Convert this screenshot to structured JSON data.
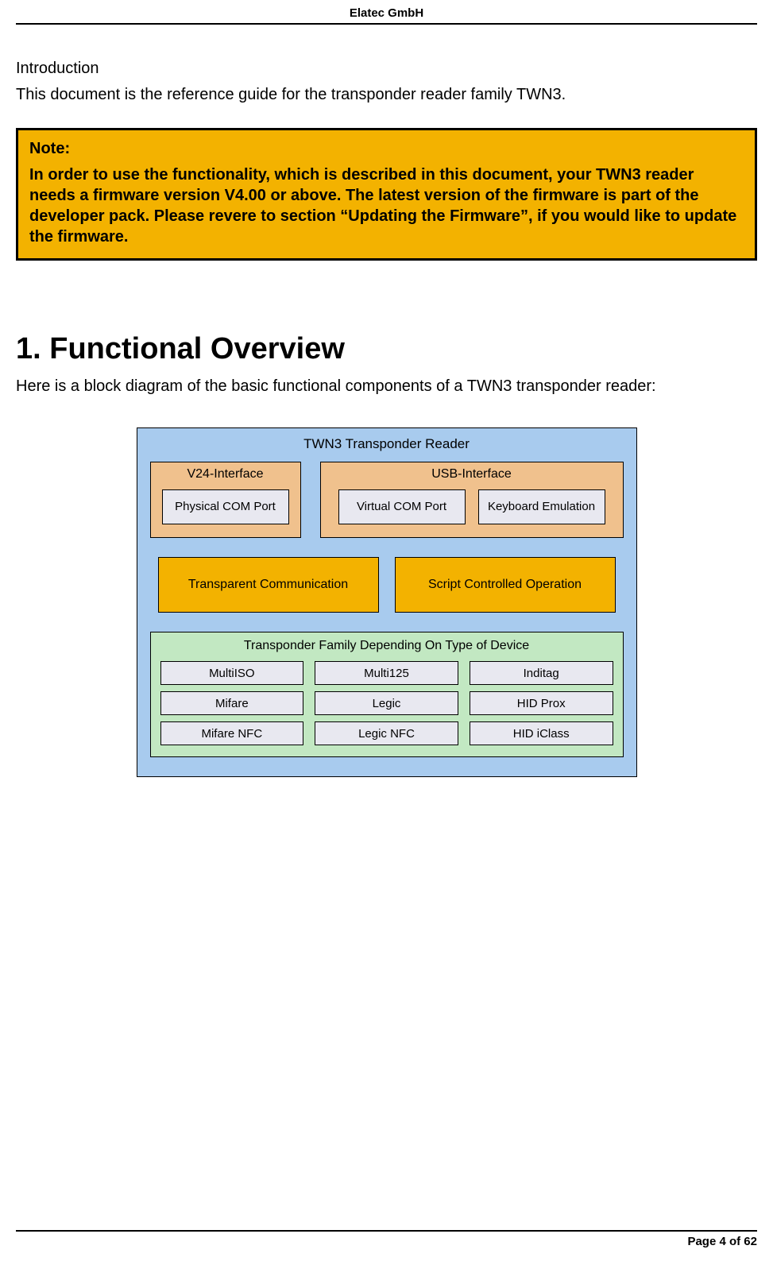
{
  "header": {
    "company": "Elatec GmbH"
  },
  "intro": {
    "label": "Introduction",
    "text": "This document is the reference guide for the transponder reader family TWN3."
  },
  "note": {
    "title": "Note:",
    "body": "In order to use the functionality, which is described in this document, your TWN3 reader needs a firmware version V4.00 or above. The latest version of the firmware is part of the developer pack. Please revere to section “Updating the Firmware”, if you would like to update the firmware."
  },
  "section": {
    "heading": "1. Functional Overview",
    "text": "Here is a block diagram of the basic functional components of a TWN3 transponder reader:"
  },
  "diagram": {
    "title": "TWN3 Transponder Reader",
    "v24": {
      "label": "V24-Interface",
      "port": "Physical COM Port"
    },
    "usb": {
      "label": "USB-Interface",
      "port1": "Virtual COM Port",
      "port2": "Keyboard Emulation"
    },
    "mode1": "Transparent Communication",
    "mode2": "Script Controlled Operation",
    "family": {
      "title": "Transponder Family Depending On Type of Device",
      "cells": [
        "MultiISO",
        "Multi125",
        "Inditag",
        "Mifare",
        "Legic",
        "HID Prox",
        "Mifare NFC",
        "Legic NFC",
        "HID iClass"
      ]
    }
  },
  "footer": {
    "page": "Page 4 of 62"
  }
}
